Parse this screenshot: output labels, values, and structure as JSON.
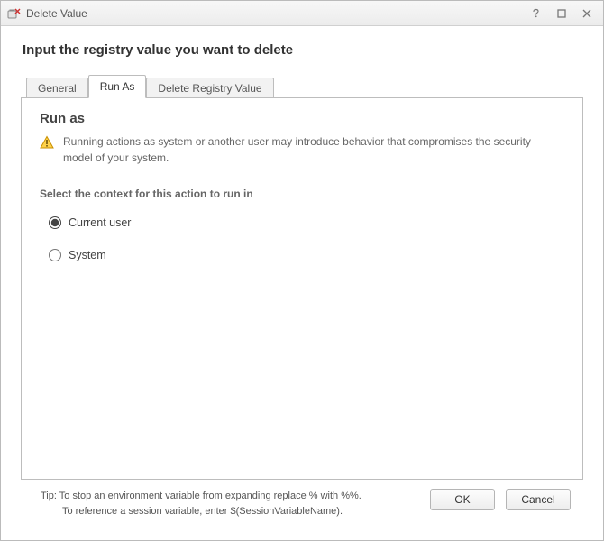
{
  "window": {
    "title": "Delete Value"
  },
  "heading": "Input the registry value you want to delete",
  "tabs": [
    {
      "label": "General",
      "active": false
    },
    {
      "label": "Run As",
      "active": true
    },
    {
      "label": "Delete Registry Value",
      "active": false
    }
  ],
  "panel": {
    "section_title": "Run as",
    "warning_text": "Running actions as system or another user may introduce behavior that compromises the security model of your system.",
    "context_label": "Select the context for this action to run in",
    "options": {
      "current_user": "Current user",
      "system": "System"
    },
    "selected": "current_user"
  },
  "footer": {
    "tip_line1": "Tip: To stop an environment variable from expanding replace % with %%.",
    "tip_line2": "To reference a session variable, enter $(SessionVariableName).",
    "ok_label": "OK",
    "cancel_label": "Cancel"
  },
  "icons": {
    "app": "delete-value-icon",
    "help": "help-icon",
    "maximize": "maximize-icon",
    "close": "close-icon",
    "warning": "warning-icon"
  }
}
